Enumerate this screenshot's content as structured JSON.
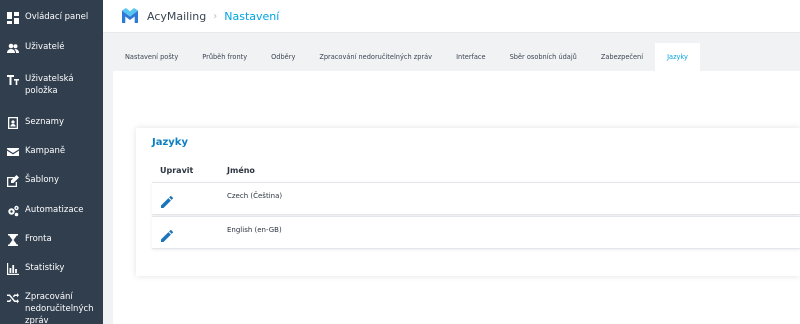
{
  "sidebar": {
    "items": [
      {
        "label": "Ovládací panel",
        "icon": "dashboard-icon"
      },
      {
        "label": "Uživatelé",
        "icon": "users-icon"
      },
      {
        "label": "Uživatelská položka",
        "icon": "text-field-icon"
      },
      {
        "label": "Seznamy",
        "icon": "address-book-icon"
      },
      {
        "label": "Kampaně",
        "icon": "envelope-icon"
      },
      {
        "label": "Šablony",
        "icon": "edit-icon"
      },
      {
        "label": "Automatizace",
        "icon": "cogs-icon"
      },
      {
        "label": "Fronta",
        "icon": "hourglass-icon"
      },
      {
        "label": "Statistiky",
        "icon": "bar-chart-icon"
      },
      {
        "label": "Zpracování nedoručitelných zpráv",
        "icon": "shuffle-icon"
      }
    ]
  },
  "header": {
    "brand": "AcyMailing",
    "separator": "›",
    "crumb": "Nastavení"
  },
  "tabs": [
    {
      "label": "Nastavení pošty",
      "active": false
    },
    {
      "label": "Průběh fronty",
      "active": false
    },
    {
      "label": "Odběry",
      "active": false
    },
    {
      "label": "Zpracování nedoručitelných zpráv",
      "active": false
    },
    {
      "label": "Interface",
      "active": false
    },
    {
      "label": "Sběr osobních údajů",
      "active": false
    },
    {
      "label": "Zabezpečení",
      "active": false
    },
    {
      "label": "Jazyky",
      "active": true
    }
  ],
  "card": {
    "title": "Jazyky",
    "columns": [
      "Upravit",
      "Jméno"
    ],
    "rows": [
      {
        "name": "Czech (Čeština)"
      },
      {
        "name": "English (en-GB)"
      }
    ]
  },
  "colors": {
    "sidebar_bg": "#303e4e",
    "accent": "#00a4e4",
    "title_blue": "#0d7fc0",
    "edit_icon": "#1b75bb"
  }
}
